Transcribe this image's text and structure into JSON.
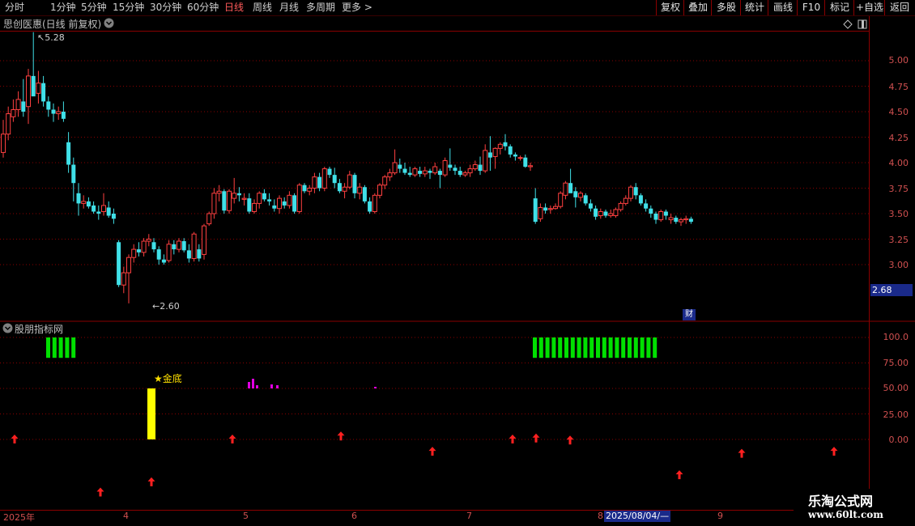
{
  "toolbar": {
    "left_items": [
      "分时",
      "1分钟",
      "5分钟",
      "15分钟",
      "30分钟",
      "60分钟",
      "日线",
      "周线",
      "月线",
      "多周期",
      "更多 >"
    ],
    "active": "日线",
    "right_items": [
      "复权",
      "叠加",
      "多股",
      "统计",
      "画线",
      "F10",
      "标记",
      "+自选",
      "返回"
    ]
  },
  "main_panel": {
    "title": "思创医惠(日线 前复权)",
    "high_label": "5.28",
    "low_label": "2.60",
    "price_axis": [
      "5.00",
      "4.75",
      "4.50",
      "4.25",
      "4.00",
      "3.75",
      "3.50",
      "3.25",
      "3.00"
    ],
    "current_price": "2.68",
    "finance_badge": "财"
  },
  "indicator_panel": {
    "title": "股朋指标网",
    "axis": [
      "100.0",
      "75.00",
      "50.00",
      "25.00",
      "0.00"
    ],
    "signal_label": "★金底"
  },
  "time_axis": {
    "labels": [
      "2025年",
      "4",
      "5",
      "6",
      "7",
      "8",
      "9"
    ],
    "cursor_date": "2025/08/04/—"
  },
  "watermark": {
    "title": "乐淘公式网",
    "url": "www.60lt.com"
  },
  "colors": {
    "up": "#ff4040",
    "down": "#40e0e8",
    "signal_green": "#00e000",
    "signal_yellow": "#ffff00",
    "signal_magenta": "#e000e0",
    "arrow": "#ff2020",
    "grid": "#8a0000"
  },
  "chart_data": {
    "type": "candlestick",
    "ylim": [
      2.55,
      5.4
    ],
    "candles": [
      [
        4.1,
        4.42,
        4.05,
        4.28
      ],
      [
        4.28,
        4.55,
        4.22,
        4.48
      ],
      [
        4.45,
        4.62,
        4.4,
        4.52
      ],
      [
        4.52,
        4.7,
        4.45,
        4.62
      ],
      [
        4.6,
        4.82,
        4.45,
        4.5
      ],
      [
        4.55,
        4.92,
        4.38,
        4.85
      ],
      [
        4.85,
        5.28,
        4.7,
        4.65
      ],
      [
        4.68,
        4.9,
        4.58,
        4.78
      ],
      [
        4.78,
        4.85,
        4.55,
        4.6
      ],
      [
        4.6,
        4.65,
        4.45,
        4.52
      ],
      [
        4.52,
        4.58,
        4.4,
        4.48
      ],
      [
        4.48,
        4.55,
        4.42,
        4.5
      ],
      [
        4.5,
        4.6,
        4.4,
        4.43
      ],
      [
        4.2,
        4.3,
        3.9,
        3.98
      ],
      [
        3.98,
        4.05,
        3.62,
        3.8
      ],
      [
        3.7,
        3.8,
        3.48,
        3.6
      ],
      [
        3.6,
        3.68,
        3.55,
        3.62
      ],
      [
        3.62,
        3.66,
        3.55,
        3.57
      ],
      [
        3.58,
        3.62,
        3.5,
        3.52
      ],
      [
        3.52,
        3.58,
        3.44,
        3.5
      ],
      [
        3.52,
        3.7,
        3.48,
        3.58
      ],
      [
        3.56,
        3.62,
        3.46,
        3.48
      ],
      [
        3.5,
        3.55,
        3.4,
        3.45
      ],
      [
        3.22,
        3.24,
        2.78,
        2.8
      ],
      [
        2.8,
        2.98,
        2.72,
        2.92
      ],
      [
        2.92,
        3.1,
        2.62,
        3.07
      ],
      [
        3.07,
        3.2,
        3.02,
        3.15
      ],
      [
        3.15,
        3.22,
        3.08,
        3.12
      ],
      [
        3.12,
        3.26,
        3.08,
        3.23
      ],
      [
        3.23,
        3.3,
        3.18,
        3.25
      ],
      [
        3.22,
        3.26,
        3.12,
        3.15
      ],
      [
        3.15,
        3.18,
        3.0,
        3.05
      ],
      [
        3.05,
        3.1,
        3.0,
        3.02
      ],
      [
        3.04,
        3.24,
        3.02,
        3.2
      ],
      [
        3.2,
        3.24,
        3.1,
        3.15
      ],
      [
        3.15,
        3.26,
        3.12,
        3.23
      ],
      [
        3.23,
        3.26,
        3.12,
        3.14
      ],
      [
        3.14,
        3.2,
        3.02,
        3.06
      ],
      [
        3.06,
        3.32,
        3.03,
        3.3
      ],
      [
        3.15,
        3.2,
        3.03,
        3.06
      ],
      [
        3.1,
        3.4,
        3.05,
        3.38
      ],
      [
        3.4,
        3.52,
        3.38,
        3.5
      ],
      [
        3.5,
        3.75,
        3.45,
        3.7
      ],
      [
        3.7,
        3.78,
        3.62,
        3.72
      ],
      [
        3.72,
        3.74,
        3.5,
        3.53
      ],
      [
        3.53,
        3.74,
        3.5,
        3.72
      ],
      [
        3.65,
        3.85,
        3.6,
        3.7
      ],
      [
        3.7,
        3.76,
        3.62,
        3.68
      ],
      [
        3.64,
        3.7,
        3.58,
        3.65
      ],
      [
        3.65,
        3.7,
        3.5,
        3.52
      ],
      [
        3.52,
        3.64,
        3.5,
        3.6
      ],
      [
        3.6,
        3.72,
        3.55,
        3.7
      ],
      [
        3.7,
        3.74,
        3.62,
        3.64
      ],
      [
        3.64,
        3.7,
        3.58,
        3.62
      ],
      [
        3.58,
        3.64,
        3.52,
        3.55
      ],
      [
        3.55,
        3.68,
        3.5,
        3.65
      ],
      [
        3.62,
        3.66,
        3.55,
        3.58
      ],
      [
        3.58,
        3.72,
        3.55,
        3.68
      ],
      [
        3.68,
        3.7,
        3.5,
        3.52
      ],
      [
        3.52,
        3.8,
        3.5,
        3.78
      ],
      [
        3.78,
        3.8,
        3.7,
        3.72
      ],
      [
        3.72,
        3.78,
        3.68,
        3.75
      ],
      [
        3.75,
        3.9,
        3.7,
        3.86
      ],
      [
        3.86,
        3.9,
        3.72,
        3.75
      ],
      [
        3.75,
        3.96,
        3.72,
        3.94
      ],
      [
        3.94,
        3.96,
        3.85,
        3.88
      ],
      [
        3.88,
        3.95,
        3.75,
        3.8
      ],
      [
        3.8,
        3.84,
        3.7,
        3.72
      ],
      [
        3.72,
        3.8,
        3.65,
        3.76
      ],
      [
        3.76,
        3.92,
        3.74,
        3.88
      ],
      [
        3.88,
        3.9,
        3.65,
        3.7
      ],
      [
        3.7,
        3.8,
        3.64,
        3.76
      ],
      [
        3.76,
        3.78,
        3.6,
        3.62
      ],
      [
        3.62,
        3.66,
        3.5,
        3.52
      ],
      [
        3.52,
        3.7,
        3.5,
        3.68
      ],
      [
        3.68,
        3.8,
        3.65,
        3.78
      ],
      [
        3.78,
        3.88,
        3.74,
        3.86
      ],
      [
        3.86,
        3.94,
        3.82,
        3.9
      ],
      [
        3.9,
        4.13,
        3.88,
        4.0
      ],
      [
        3.98,
        4.04,
        3.9,
        3.94
      ],
      [
        3.94,
        4.0,
        3.88,
        3.9
      ],
      [
        3.9,
        3.96,
        3.86,
        3.88
      ],
      [
        3.88,
        3.96,
        3.86,
        3.94
      ],
      [
        3.92,
        3.96,
        3.86,
        3.89
      ],
      [
        3.89,
        3.96,
        3.86,
        3.92
      ],
      [
        3.92,
        3.94,
        3.84,
        3.9
      ],
      [
        3.9,
        4.0,
        3.88,
        3.96
      ],
      [
        3.92,
        3.94,
        3.75,
        3.88
      ],
      [
        3.88,
        4.05,
        3.86,
        4.02
      ],
      [
        3.98,
        4.14,
        3.92,
        3.95
      ],
      [
        3.95,
        3.98,
        3.88,
        3.92
      ],
      [
        3.92,
        3.96,
        3.86,
        3.88
      ],
      [
        3.88,
        3.92,
        3.86,
        3.9
      ],
      [
        3.9,
        3.98,
        3.86,
        3.94
      ],
      [
        3.94,
        4.02,
        3.92,
        3.98
      ],
      [
        3.98,
        4.06,
        3.88,
        3.92
      ],
      [
        3.92,
        4.18,
        3.9,
        4.12
      ],
      [
        4.1,
        4.26,
        3.92,
        4.05
      ],
      [
        4.06,
        4.15,
        3.94,
        4.14
      ],
      [
        4.14,
        4.2,
        4.08,
        4.18
      ],
      [
        4.2,
        4.28,
        4.12,
        4.16
      ],
      [
        4.16,
        4.18,
        4.05,
        4.08
      ],
      [
        4.08,
        4.1,
        4.02,
        4.06
      ],
      [
        4.05,
        4.07,
        4.02,
        4.05
      ],
      [
        4.05,
        4.08,
        3.95,
        3.96
      ],
      [
        3.96,
        4.0,
        3.92,
        3.97
      ],
      [
        3.65,
        3.75,
        3.4,
        3.42
      ],
      [
        3.45,
        3.6,
        3.42,
        3.56
      ],
      [
        3.56,
        3.6,
        3.5,
        3.53
      ],
      [
        3.54,
        3.58,
        3.5,
        3.55
      ],
      [
        3.55,
        3.6,
        3.54,
        3.57
      ],
      [
        3.57,
        3.72,
        3.55,
        3.7
      ],
      [
        3.68,
        3.82,
        3.64,
        3.8
      ],
      [
        3.8,
        3.94,
        3.72,
        3.7
      ],
      [
        3.72,
        3.76,
        3.56,
        3.66
      ],
      [
        3.66,
        3.72,
        3.62,
        3.7
      ],
      [
        3.68,
        3.7,
        3.58,
        3.6
      ],
      [
        3.6,
        3.64,
        3.52,
        3.55
      ],
      [
        3.55,
        3.58,
        3.44,
        3.47
      ],
      [
        3.48,
        3.55,
        3.45,
        3.52
      ],
      [
        3.52,
        3.54,
        3.46,
        3.48
      ],
      [
        3.48,
        3.54,
        3.46,
        3.5
      ],
      [
        3.48,
        3.56,
        3.46,
        3.54
      ],
      [
        3.54,
        3.62,
        3.52,
        3.6
      ],
      [
        3.6,
        3.68,
        3.58,
        3.65
      ],
      [
        3.65,
        3.78,
        3.62,
        3.76
      ],
      [
        3.76,
        3.8,
        3.64,
        3.68
      ],
      [
        3.68,
        3.7,
        3.58,
        3.6
      ],
      [
        3.6,
        3.64,
        3.52,
        3.55
      ],
      [
        3.55,
        3.58,
        3.46,
        3.5
      ],
      [
        3.5,
        3.52,
        3.4,
        3.44
      ],
      [
        3.44,
        3.54,
        3.42,
        3.52
      ],
      [
        3.52,
        3.54,
        3.44,
        3.48
      ],
      [
        3.44,
        3.5,
        3.4,
        3.46
      ],
      [
        3.46,
        3.48,
        3.4,
        3.42
      ],
      [
        3.42,
        3.46,
        3.38,
        3.44
      ],
      [
        3.44,
        3.48,
        3.4,
        3.45
      ],
      [
        3.45,
        3.47,
        3.4,
        3.42
      ]
    ],
    "indicator": {
      "green_bars_1": {
        "from": 0,
        "count": 5,
        "y": [
          80,
          100
        ]
      },
      "green_bars_2": {
        "from": 86,
        "count": 20,
        "y": [
          80,
          100
        ]
      },
      "yellow_bar": {
        "index": 23,
        "y": [
          0,
          50
        ]
      },
      "magenta_marks": [
        40,
        41,
        44,
        45,
        60
      ],
      "arrows": [
        {
          "index": 2,
          "y": 0
        },
        {
          "index": 15,
          "y": -52
        },
        {
          "index": 23,
          "y": -42
        },
        {
          "index": 37,
          "y": 0
        },
        {
          "index": 55,
          "y": 3
        },
        {
          "index": 70,
          "y": -12
        },
        {
          "index": 83,
          "y": 0
        },
        {
          "index": 87,
          "y": 1
        },
        {
          "index": 93,
          "y": -1
        },
        {
          "index": 111,
          "y": -35
        },
        {
          "index": 121,
          "y": -14
        },
        {
          "index": 137,
          "y": -12
        }
      ]
    }
  }
}
